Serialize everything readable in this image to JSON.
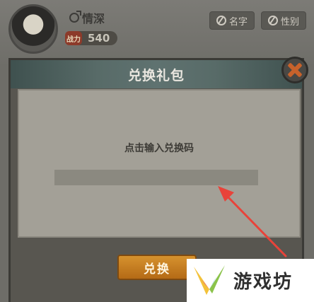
{
  "profile": {
    "player_name": "情深",
    "power_badge": "战力",
    "power_value": "540",
    "name_button": "名字",
    "gender_button": "性别"
  },
  "dialog": {
    "title": "兑换礼包",
    "prompt": "点击输入兑换码",
    "code_value": "",
    "redeem_button": "兑换"
  },
  "watermark": {
    "text": "游戏坊"
  },
  "colors": {
    "header_teal": "#586b68",
    "redeem_orange": "#c97e22",
    "close_orange": "#c8622b",
    "arrow_red": "#e8433a"
  }
}
